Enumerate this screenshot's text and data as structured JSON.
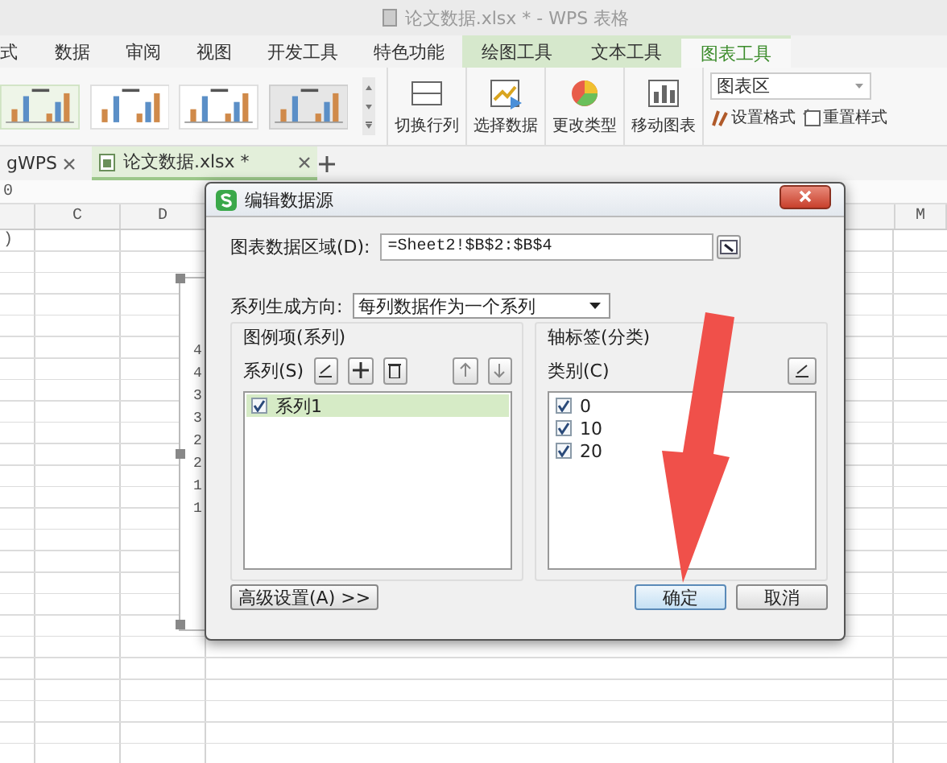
{
  "window": {
    "title": "论文数据.xlsx * - WPS 表格"
  },
  "menu_tabs": [
    {
      "label": "式",
      "kind": "plain",
      "selected": false
    },
    {
      "label": "数据",
      "kind": "plain",
      "selected": false
    },
    {
      "label": "审阅",
      "kind": "plain",
      "selected": false
    },
    {
      "label": "视图",
      "kind": "plain",
      "selected": false
    },
    {
      "label": "开发工具",
      "kind": "plain",
      "selected": false
    },
    {
      "label": "特色功能",
      "kind": "plain",
      "selected": false
    },
    {
      "label": "绘图工具",
      "kind": "context",
      "selected": false
    },
    {
      "label": "文本工具",
      "kind": "context",
      "selected": false
    },
    {
      "label": "图表工具",
      "kind": "context",
      "selected": true
    }
  ],
  "ribbon": {
    "buttons": [
      {
        "label": "切换行列",
        "kind": "switch"
      },
      {
        "label": "选择数据",
        "kind": "select"
      },
      {
        "label": "更改类型",
        "kind": "type"
      },
      {
        "label": "移动图表",
        "kind": "move"
      }
    ],
    "element_select": {
      "value": "图表区"
    },
    "small_buttons": [
      {
        "label": "设置格式",
        "kind": "format"
      },
      {
        "label": "重置样式",
        "kind": "reset"
      }
    ]
  },
  "doc_tabs": [
    {
      "label": "gWPS",
      "selected": false
    },
    {
      "label": "论文数据.xlsx *",
      "selected": true
    }
  ],
  "formula_bar": {
    "value": "0"
  },
  "sheet": {
    "columns": [
      "C",
      "D",
      "M"
    ],
    "cell": ")",
    "axis_labels": [
      "4",
      "4",
      "3",
      "3",
      "2",
      "2",
      "1",
      "1"
    ]
  },
  "dialog": {
    "title": "编辑数据源",
    "range_label": "图表数据区域(D):",
    "range_value": "=Sheet2!$B$2:$B$4",
    "direction_label": "系列生成方向:",
    "direction_value": "每列数据作为一个系列",
    "legend_group": {
      "title": "图例项(系列)",
      "label": "系列(S)",
      "items": [
        {
          "label": "系列1",
          "checked": true,
          "selected": true
        }
      ]
    },
    "axis_group": {
      "title": "轴标签(分类)",
      "label": "类别(C)",
      "items": [
        {
          "label": "0",
          "checked": true,
          "selected": false
        },
        {
          "label": "10",
          "checked": true,
          "selected": false
        },
        {
          "label": "20",
          "checked": true,
          "selected": false
        }
      ]
    },
    "advanced_button": "高级设置(A) >>",
    "buttons": [
      {
        "label": "确定",
        "kind": "primary"
      },
      {
        "label": "取消",
        "kind": "secondary"
      }
    ]
  }
}
